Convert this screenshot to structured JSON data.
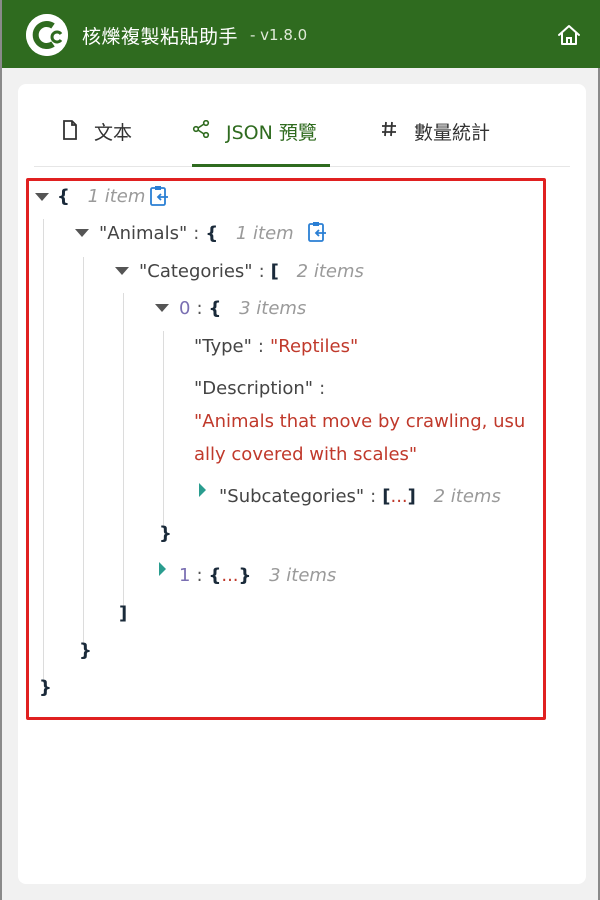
{
  "app": {
    "title": "核爍複製粘貼助手",
    "version": "- v1.8.0",
    "accent_color": "#2f6b1f"
  },
  "tabs": [
    {
      "label": "文本",
      "icon": "document-icon",
      "active": false
    },
    {
      "label": "JSON 預覽",
      "icon": "share-nodes-icon",
      "active": true
    },
    {
      "label": "數量統計",
      "icon": "hash-icon",
      "active": false
    }
  ],
  "json_view": {
    "root_open": "{",
    "root_meta": "1 item",
    "animals_key": "\"Animals\"",
    "animals_open": "{",
    "animals_meta": "1 item",
    "categories_key": "\"Categories\"",
    "categories_open": "[",
    "categories_meta": "2 items",
    "item0_index": "0",
    "item0_open": "{",
    "item0_meta": "3 items",
    "type_key": "\"Type\"",
    "type_value": "\"Reptiles\"",
    "description_key": "\"Description\"",
    "description_value_line1": "\"Animals that move by crawling, usu",
    "description_value_line2": "ally covered with scales\"",
    "subcategories_key": "\"Subcategories\"",
    "subcategories_open": "[",
    "subcategories_ellipsis": "...",
    "subcategories_close": "]",
    "subcategories_meta": "2 items",
    "item0_close": "}",
    "item1_index": "1",
    "item1_open": "{",
    "item1_ellipsis": "...",
    "item1_close": "}",
    "item1_meta": "3 items",
    "categories_close": "]",
    "animals_close": "}",
    "root_close": "}",
    "colon": ":"
  }
}
